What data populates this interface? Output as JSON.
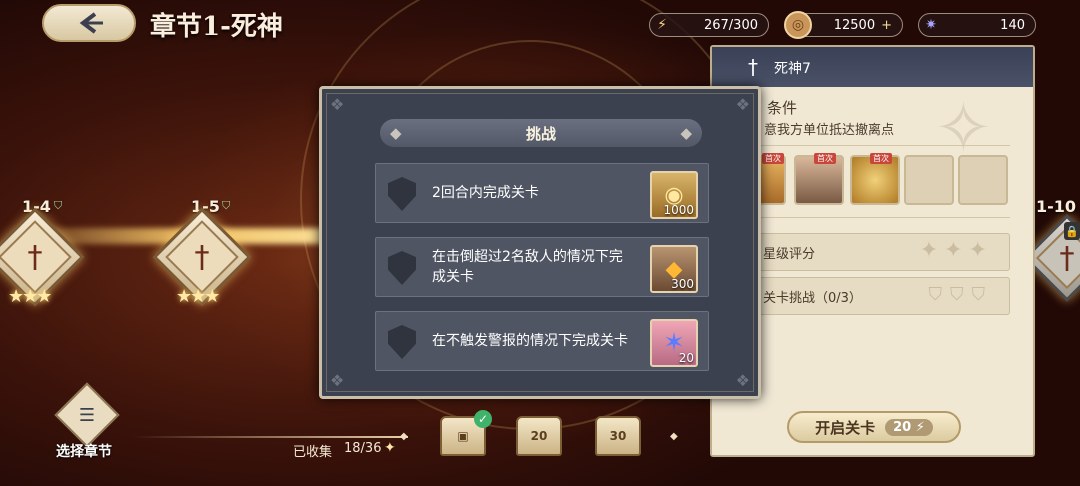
{
  "header": {
    "chapter_title": "章节1-死神",
    "back_icon": "back-arrow-icon"
  },
  "resources": {
    "stamina": {
      "icon": "lightning-icon",
      "value": "267/300"
    },
    "coins": {
      "icon": "coin-icon",
      "value": "12500",
      "add_label": "+"
    },
    "gems": {
      "icon": "star-crystal-icon",
      "value": "140"
    }
  },
  "stages": [
    {
      "label": "1-4",
      "stars": "★★★"
    },
    {
      "label": "1-5",
      "stars": "★★★"
    },
    {
      "label": "1-10",
      "locked": true
    }
  ],
  "dialog": {
    "title": "挑战",
    "tasks": [
      {
        "text": "2回合内完成关卡",
        "reward_icon": "gold-coin-icon",
        "reward_count": "1000"
      },
      {
        "text": "在击倒超过2名敌人的情况下完成关卡",
        "reward_icon": "amber-gem-icon",
        "reward_count": "300"
      },
      {
        "text": "在不触发警报的情况下完成关卡",
        "reward_icon": "blue-crystal-icon",
        "reward_count": "20"
      }
    ]
  },
  "panel": {
    "stage_name": "死神7",
    "condition_title": "条件",
    "condition_text": "意我方单位抵达撤离点",
    "loot_tag": "首次",
    "star_rating_label": "星级评分",
    "challenge_label": "关卡挑战（0/3）",
    "start_label": "开启关卡",
    "start_cost": "20"
  },
  "bottom": {
    "select_chapter": "选择章节",
    "collected_label": "已收集",
    "collected_value": "18/36",
    "chests": [
      {
        "label": "",
        "claimed": true
      },
      {
        "label": "20"
      },
      {
        "label": "30"
      }
    ]
  }
}
